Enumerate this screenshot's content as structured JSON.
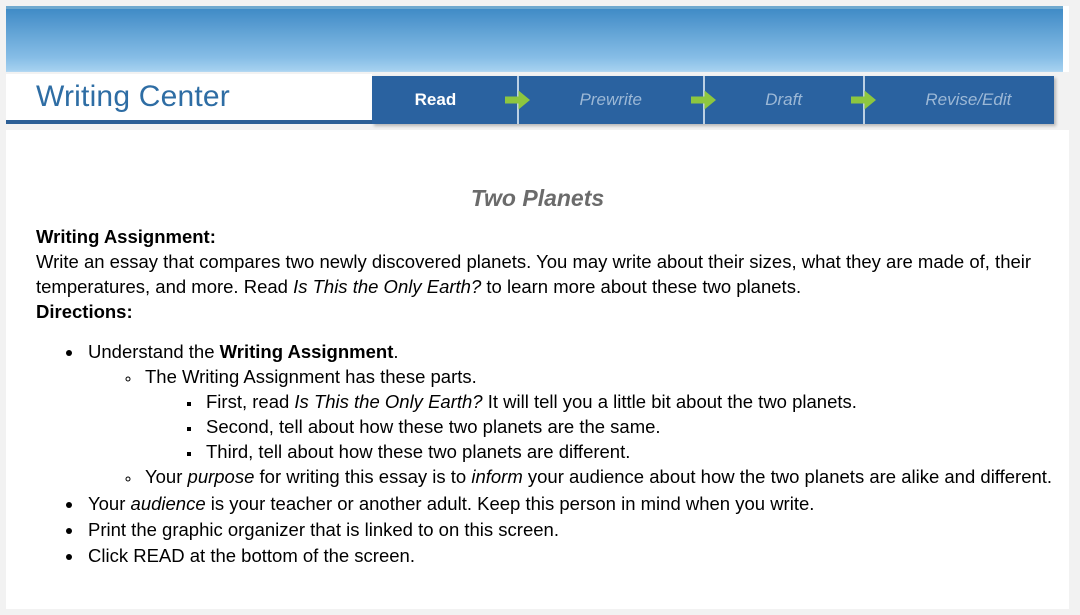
{
  "banner": {
    "name": "decorative-blue-gradient-banner"
  },
  "header": {
    "brand_title": "Writing Center",
    "steps": [
      {
        "label": "Read",
        "state": "active"
      },
      {
        "label": "Prewrite",
        "state": "inactive"
      },
      {
        "label": "Draft",
        "state": "inactive"
      },
      {
        "label": "Revise/Edit",
        "state": "inactive"
      }
    ],
    "separator_icon": "arrow-right-icon"
  },
  "document": {
    "title": "Two Planets",
    "assignment_label": "Writing Assignment:",
    "assignment_text_1": "Write an essay that compares two newly discovered planets. You may write about their sizes, what they are made of, their temperatures, and more. Read ",
    "assignment_book_title": "Is This the Only Earth?",
    "assignment_text_2": " to learn more about these two planets.",
    "directions_label": "Directions:",
    "bullets": {
      "b1_pre": "Understand the ",
      "b1_bold": "Writing Assignment",
      "b1_post": ".",
      "b2": "The Writing Assignment has these parts.",
      "b3_pre": "First, read ",
      "b3_ital": "Is This the Only Earth?",
      "b3_post": " It will tell you a little bit about the two planets.",
      "b4": "Second, tell about how these two planets are the same.",
      "b5": "Third, tell about how these two planets are different.",
      "b6_pre": "Your ",
      "b6_ital1": "purpose",
      "b6_mid": " for writing this essay is to ",
      "b6_ital2": "inform",
      "b6_post": " your audience about how the two planets are alike and different.",
      "b7_pre": "Your ",
      "b7_ital": "audience",
      "b7_post": " is your teacher or another adult. Keep this person in mind when you write.",
      "b8": "Print the graphic organizer that is linked to on this screen.",
      "b9": "Click READ at the bottom of the screen."
    }
  },
  "colors": {
    "nav_background": "#2a62a0",
    "brand_blue": "#2e6da4",
    "arrow_green": "#8dc63f",
    "inactive_step": "#9cb8d6",
    "title_gray": "#6b6b6b"
  }
}
